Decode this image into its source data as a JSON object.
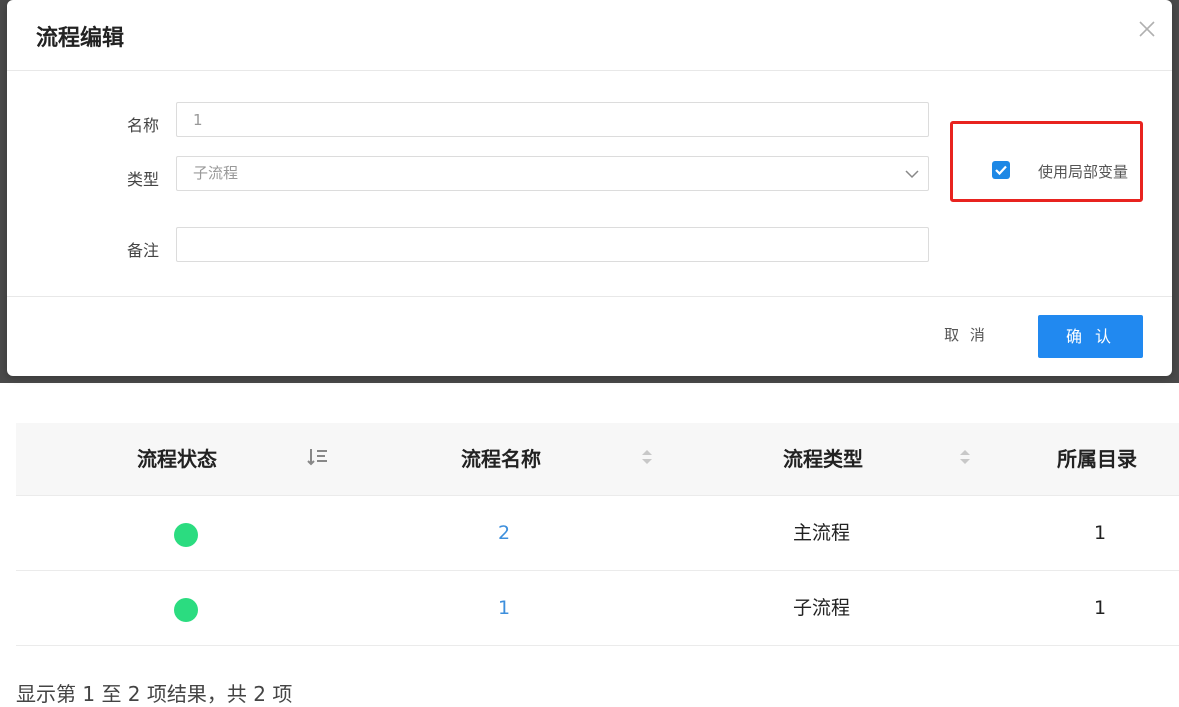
{
  "modal": {
    "title": "流程编辑",
    "close_icon": "close-icon",
    "fields": {
      "name": {
        "label": "名称",
        "value": "1"
      },
      "type": {
        "label": "类型",
        "value": "子流程"
      },
      "remark": {
        "label": "备注",
        "value": ""
      }
    },
    "checkbox": {
      "label": "使用局部变量",
      "checked": true
    },
    "buttons": {
      "cancel": "取 消",
      "confirm": "确 认"
    },
    "colors": {
      "primary": "#2189f0",
      "highlight": "#e8231f",
      "checkbox": "#1e88e5"
    }
  },
  "table": {
    "headers": [
      {
        "label": "流程状态",
        "sort": "sort-descending-icon"
      },
      {
        "label": "流程名称",
        "sort": "sort-toggle-icon"
      },
      {
        "label": "流程类型",
        "sort": "sort-toggle-icon"
      },
      {
        "label": "所属目录",
        "sort": ""
      }
    ],
    "rows": [
      {
        "status": "active",
        "name": "2",
        "type": "主流程",
        "dir": "1"
      },
      {
        "status": "active",
        "name": "1",
        "type": "子流程",
        "dir": "1"
      }
    ],
    "status_color": "#2bdc80",
    "footer": "显示第 1 至 2 项结果，共 2 项"
  }
}
